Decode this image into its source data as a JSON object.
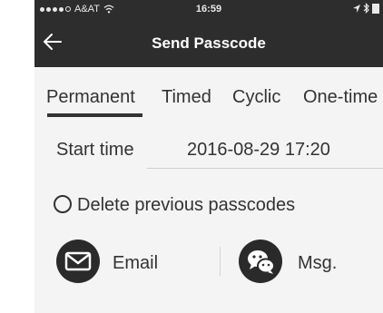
{
  "status_bar": {
    "carrier": "A&AT",
    "time": "16:59"
  },
  "nav": {
    "title": "Send Passcode"
  },
  "tabs": [
    {
      "label": "Permanent",
      "selected": true
    },
    {
      "label": "Timed",
      "selected": false
    },
    {
      "label": "Cyclic",
      "selected": false
    },
    {
      "label": "One-time",
      "selected": false
    }
  ],
  "start_time": {
    "label": "Start time",
    "value": "2016-08-29 17:20"
  },
  "delete_option": {
    "label": "Delete previous passcodes",
    "checked": false
  },
  "share": {
    "email_label": "Email",
    "msg_label": "Msg."
  },
  "colors": {
    "nav_background": "#2d2d2d",
    "page_background": "#f4f4f4",
    "text": "#333333",
    "icon_background": "#2a2a2a"
  }
}
